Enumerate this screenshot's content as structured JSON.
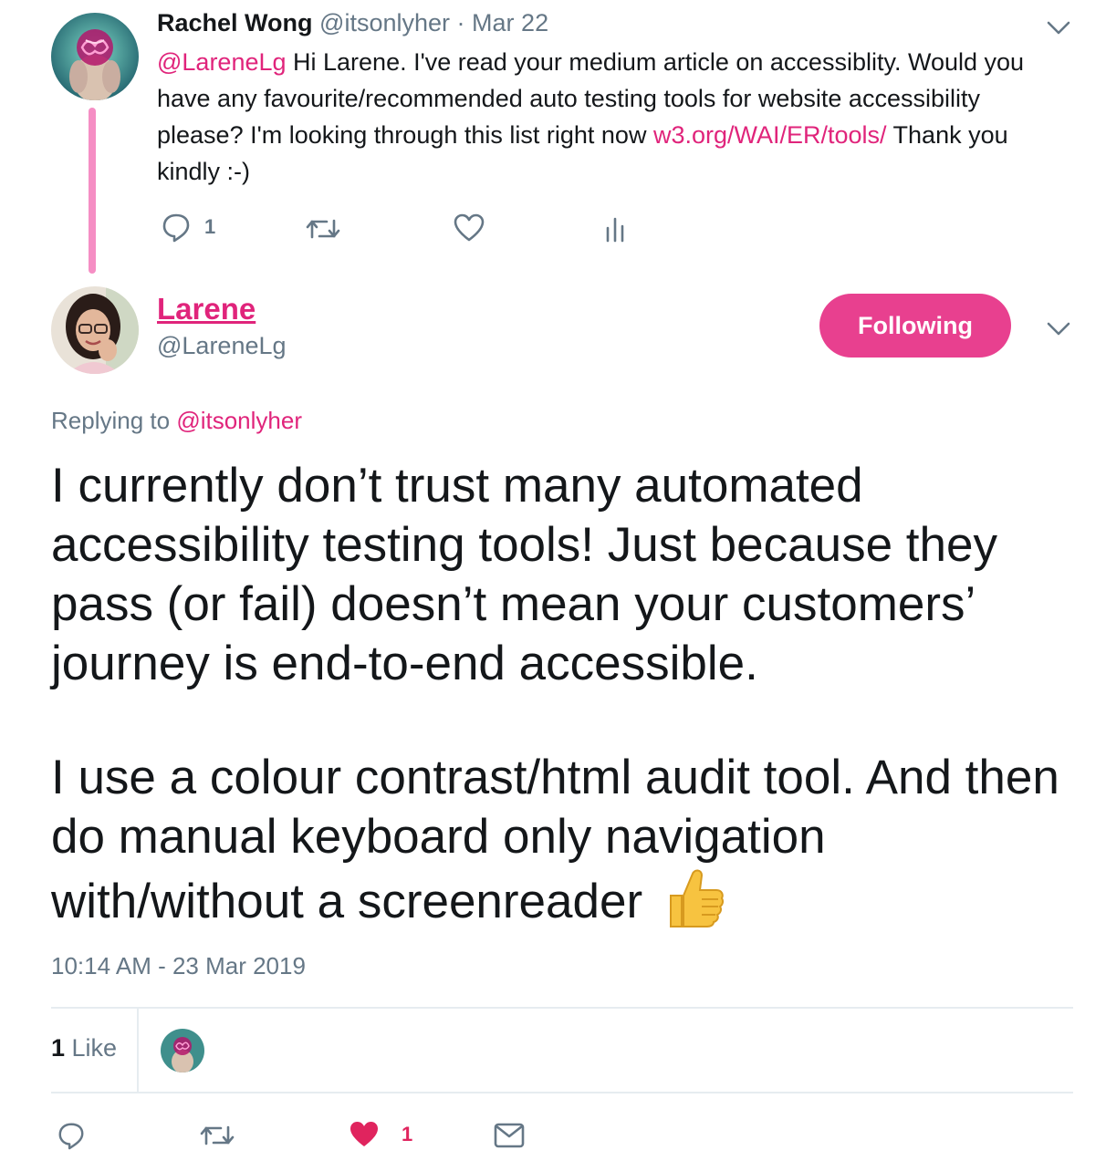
{
  "parent_tweet": {
    "author_name": "Rachel Wong",
    "author_handle": "@itsonlyher",
    "separator": "·",
    "date": "Mar 22",
    "mention": "@LareneLg",
    "text_part1": " Hi Larene. I've read your medium article on accessiblity. Would you have any favourite/recommended auto testing tools for website accessibility please? I'm looking through this list right now ",
    "link": "w3.org/WAI/ER/tools/",
    "text_part2": " Thank you kindly :-)",
    "reply_count": "1",
    "avatar_icon": "brain-face-avatar",
    "icons": [
      "reply-icon",
      "retweet-icon",
      "heart-outline-icon",
      "analytics-icon",
      "chevron-down-icon"
    ]
  },
  "reply_tweet": {
    "author_name": "Larene",
    "author_handle": "@LareneLg",
    "follow_button": "Following",
    "replying_to_label": "Replying to ",
    "replying_to_handle": "@itsonlyher",
    "paragraph1": "I currently don’t trust many automated accessibility testing tools! Just because they pass (or fail) doesn’t mean your customers’ journey is end-to-end accessible.",
    "paragraph2": "I use a colour contrast/html audit tool. And then do manual keyboard only navigation with/without a screenreader",
    "emoji": "thumbs-up",
    "timestamp": "10:14 AM - 23 Mar 2019",
    "like_count": "1",
    "like_label": " Like",
    "heart_count": "1",
    "icons": [
      "reply-icon",
      "retweet-icon",
      "heart-filled-icon",
      "mail-icon",
      "chevron-down-icon"
    ]
  },
  "colors": {
    "accent": "#e0247b",
    "follow_button": "#e8408f",
    "thread_line": "#f58ec4",
    "text_gray": "#657786",
    "heart": "#e0245e"
  }
}
